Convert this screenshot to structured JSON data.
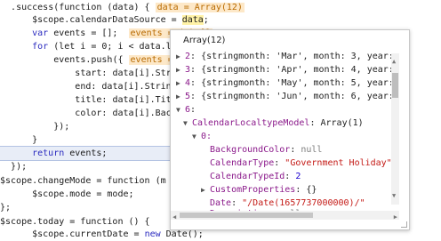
{
  "code_lines": [
    {
      "indent": "  ",
      "text": ".success(function (data) {",
      "tag": "data = Array(12)"
    },
    {
      "indent": "      ",
      "pre": "$scope.calendarDataSource = ",
      "hl": "data",
      "post": ";"
    },
    {
      "indent": "      ",
      "kw": "var",
      "post": " events = [];",
      "tag": "events = (0) []"
    },
    {
      "indent": "      ",
      "kw": "for",
      "post": " (let i = 0; i < data.le"
    },
    {
      "indent": "          ",
      "text": "events.push({",
      "tag": "events ="
    },
    {
      "indent": "              ",
      "text": "start: data[i].Stri"
    },
    {
      "indent": "              ",
      "text": "end: data[i].String"
    },
    {
      "indent": "              ",
      "text": "title: data[i].Titl"
    },
    {
      "indent": "              ",
      "text": "color: data[i].Back"
    },
    {
      "indent": "          ",
      "text": "});"
    },
    {
      "indent": "      ",
      "text": "}"
    },
    {
      "indent": "      ",
      "kw": "return",
      "post": " events;"
    },
    {
      "indent": "  ",
      "text": "});"
    },
    {
      "indent": "",
      "text": ""
    },
    {
      "indent": "",
      "text": "$scope.changeMode = function (m"
    },
    {
      "indent": "      ",
      "text": "$scope.mode = mode;"
    },
    {
      "indent": "",
      "text": "};"
    },
    {
      "indent": "",
      "text": ""
    },
    {
      "indent": "",
      "text": "$scope.today = function () {"
    },
    {
      "indent": "      ",
      "pre": "$scope.currentDate = ",
      "kw": "new",
      "post": " Date();"
    }
  ],
  "popup": {
    "title": "Array(12)",
    "rows": [
      {
        "idx": "2",
        "text": "{stringmonth: 'Mar', month: 3, year:"
      },
      {
        "idx": "3",
        "text": "{stringmonth: 'Apr', month: 4, year:"
      },
      {
        "idx": "4",
        "text": "{stringmonth: 'May', month: 5, year:"
      },
      {
        "idx": "5",
        "text": "{stringmonth: 'Jun', month: 6, year:"
      },
      {
        "idx": "6",
        "text": ""
      }
    ],
    "model": {
      "key": "CalendarLocaltypeModel",
      "value": "Array(1)"
    },
    "zero": "0:",
    "props": [
      {
        "key": "BackgroundColor",
        "value": "null",
        "type": "null"
      },
      {
        "key": "CalendarType",
        "value": "\"Government Holiday\"",
        "type": "str"
      },
      {
        "key": "CalendarTypeId",
        "value": "2",
        "type": "num"
      },
      {
        "key": "CustomProperties",
        "value": "{}",
        "type": "plain",
        "expand": true
      },
      {
        "key": "Date",
        "value": "\"/Date(1657737000000)/\"",
        "type": "str"
      },
      {
        "key": "Description",
        "value": "null",
        "type": "null"
      }
    ]
  }
}
